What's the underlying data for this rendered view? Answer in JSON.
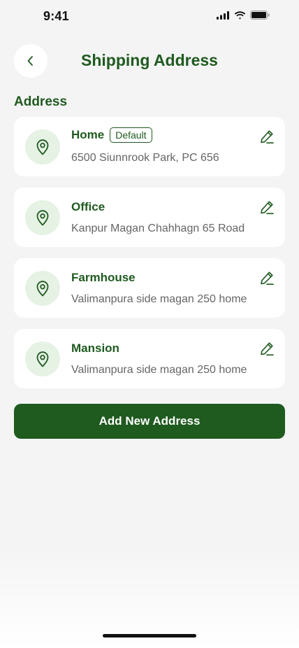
{
  "status_bar": {
    "time": "9:41"
  },
  "header": {
    "title": "Shipping Address"
  },
  "section": {
    "title": "Address"
  },
  "addresses": [
    {
      "name": "Home",
      "badge": "Default",
      "address": "6500 Siunnrook Park, PC 656"
    },
    {
      "name": "Office",
      "address": "Kanpur Magan Chahhagn 65 Road"
    },
    {
      "name": "Farmhouse",
      "address": "Valimanpura side magan 250 home"
    },
    {
      "name": "Mansion",
      "address": "Valimanpura side magan 250 home"
    }
  ],
  "actions": {
    "add_label": "Add New Address"
  },
  "colors": {
    "accent": "#1f5a1f",
    "pin_bg": "#e5f2e4",
    "background": "#f4f4f4"
  }
}
